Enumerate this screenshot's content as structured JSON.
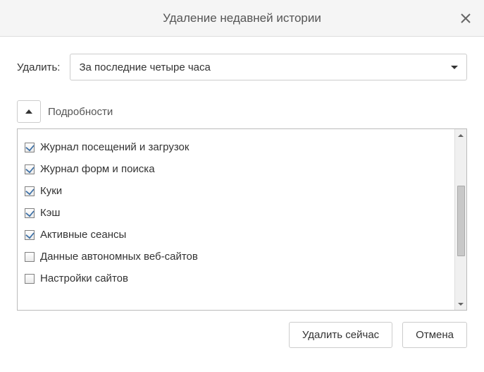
{
  "title": "Удаление недавней истории",
  "timerange": {
    "label": "Удалить:",
    "selected": "За последние четыре часа"
  },
  "details": {
    "label": "Подробности",
    "items": [
      {
        "label": "Журнал посещений и загрузок",
        "checked": true
      },
      {
        "label": "Журнал форм и поиска",
        "checked": true
      },
      {
        "label": "Куки",
        "checked": true
      },
      {
        "label": "Кэш",
        "checked": true
      },
      {
        "label": "Активные сеансы",
        "checked": true
      },
      {
        "label": "Данные автономных веб-сайтов",
        "checked": false
      },
      {
        "label": "Настройки сайтов",
        "checked": false
      }
    ]
  },
  "buttons": {
    "clear_now": "Удалить сейчас",
    "cancel": "Отмена"
  }
}
